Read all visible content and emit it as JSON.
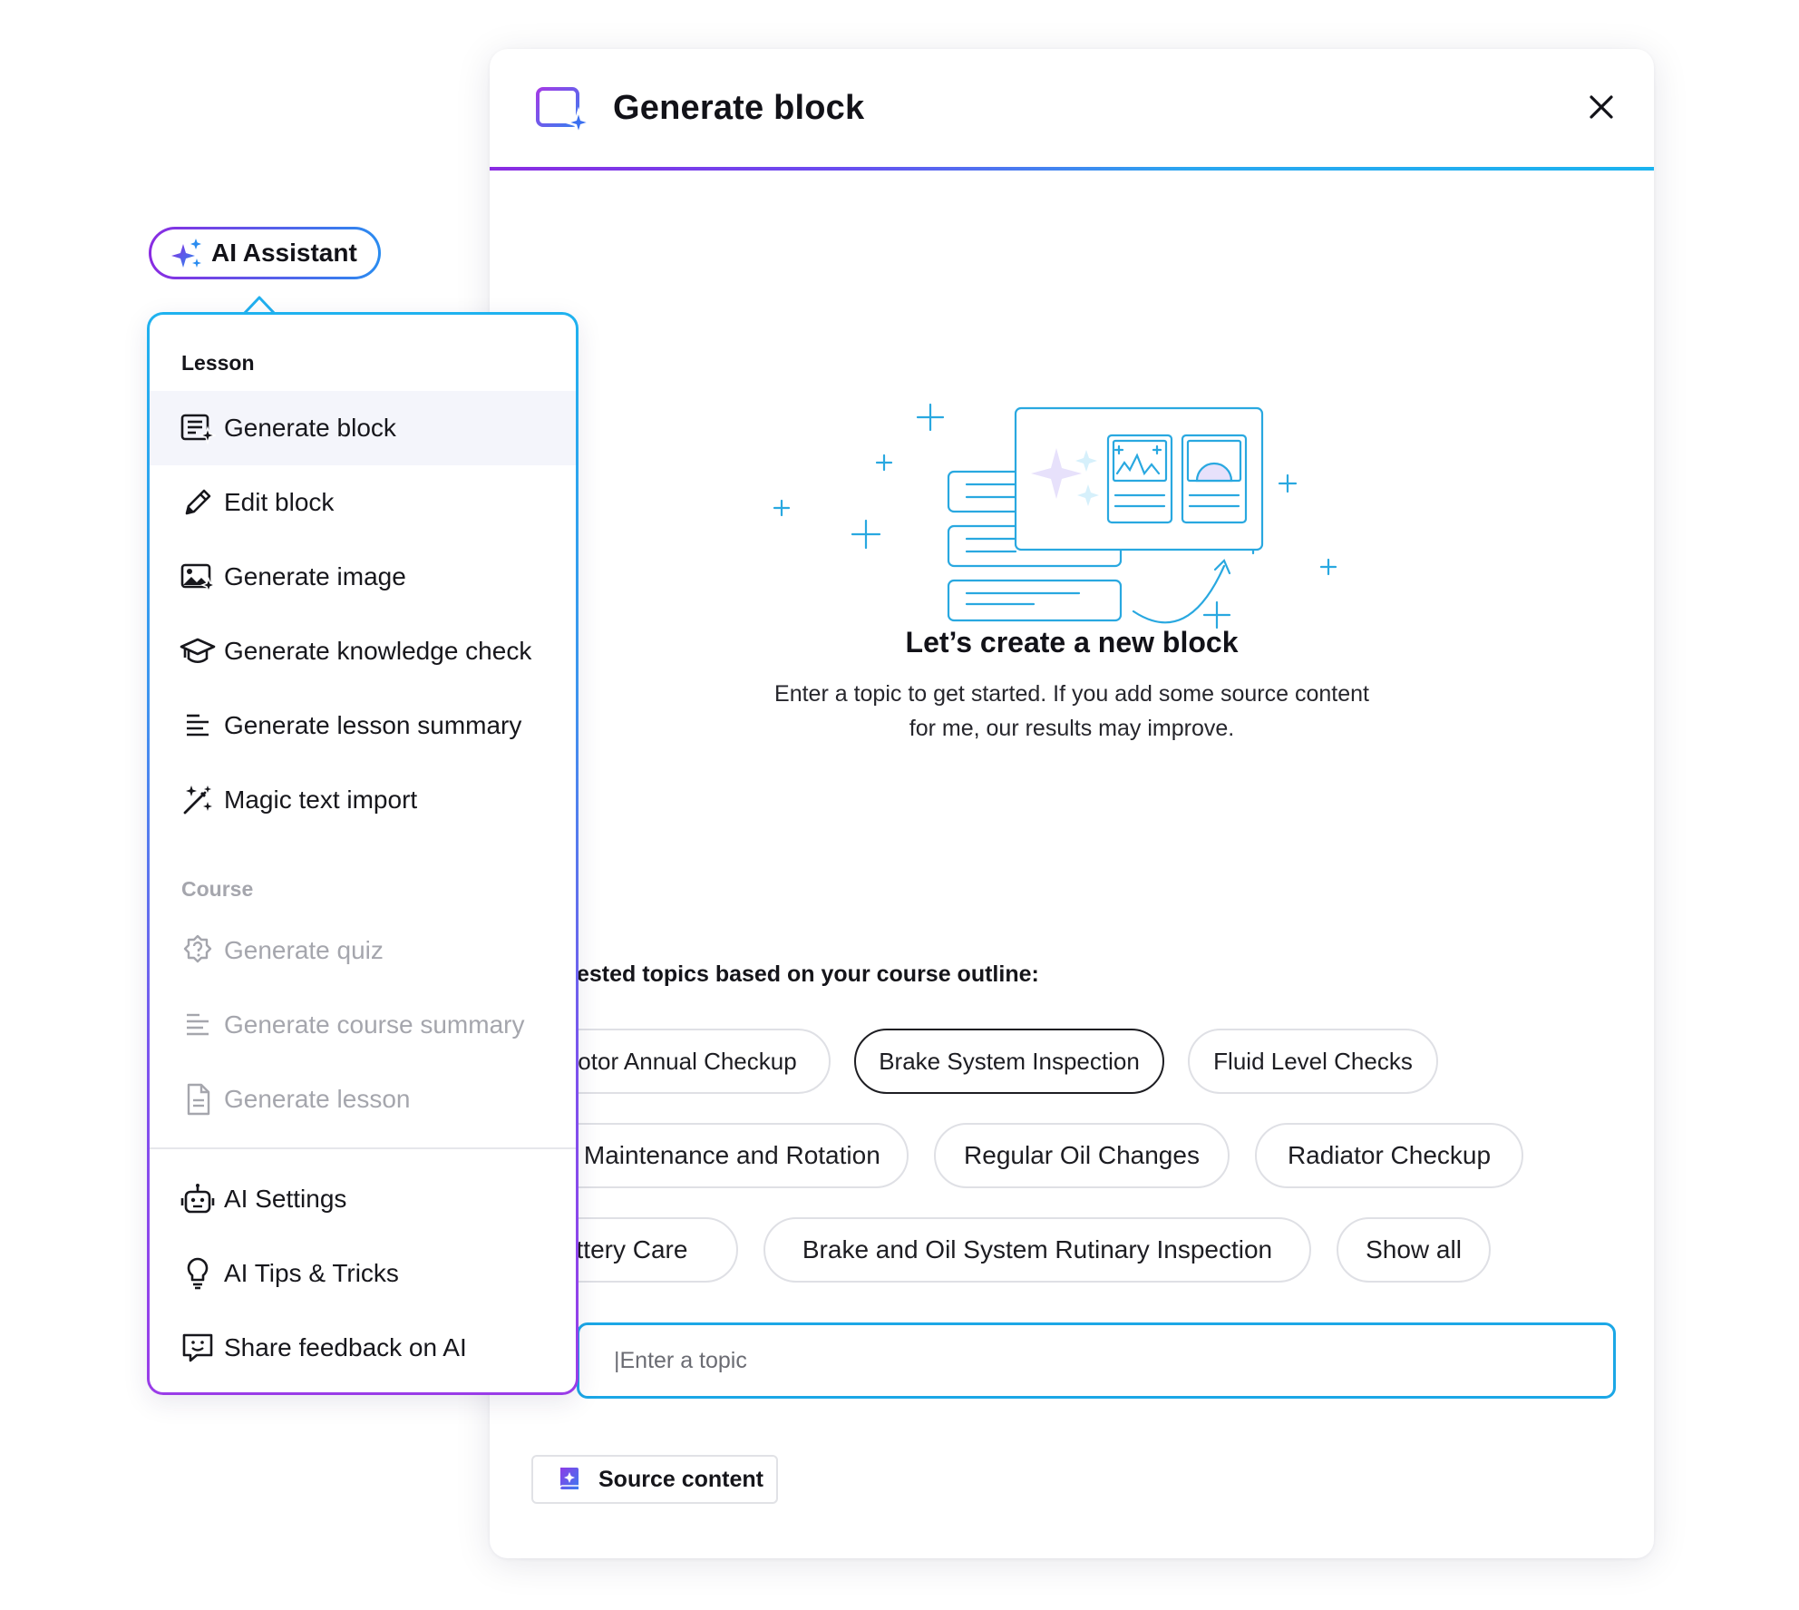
{
  "modal": {
    "title": "Generate block",
    "empty_state": {
      "title": "Let’s create a new block",
      "description": "Enter a topic to get started. If you add some source content for me, our results may improve."
    },
    "suggestions_label": "ested topics based on your course outline:",
    "chips": [
      "otor Annual Checkup",
      "Brake System Inspection",
      "Fluid Level Checks",
      "re Maintenance and Rotation",
      "Regular Oil Changes",
      "Radiator Checkup",
      "ttery Care",
      "Brake and Oil System Rutinary Inspection",
      "Show all"
    ],
    "selected_chip": "Brake System Inspection",
    "topic_input": {
      "value": "|Enter a topic"
    },
    "source_button": "Source content"
  },
  "ai_assistant": {
    "label": "AI Assistant",
    "menu": {
      "lesson_label": "Lesson",
      "lesson_items": [
        {
          "label": "Generate block",
          "icon": "generate-block-icon",
          "active": true
        },
        {
          "label": "Edit block",
          "icon": "pencil-icon"
        },
        {
          "label": "Generate image",
          "icon": "image-sparkle-icon"
        },
        {
          "label": "Generate knowledge check",
          "icon": "graduation-cap-icon"
        },
        {
          "label": "Generate lesson summary",
          "icon": "lines-icon"
        },
        {
          "label": "Magic text import",
          "icon": "magic-wand-icon"
        }
      ],
      "course_label": "Course",
      "course_items": [
        {
          "label": "Generate quiz",
          "icon": "quiz-icon",
          "disabled": true
        },
        {
          "label": "Generate course summary",
          "icon": "lines-icon",
          "disabled": true
        },
        {
          "label": "Generate lesson",
          "icon": "document-icon",
          "disabled": true
        }
      ],
      "footer_items": [
        {
          "label": "AI Settings",
          "icon": "robot-icon"
        },
        {
          "label": "AI Tips & Tricks",
          "icon": "lightbulb-icon"
        },
        {
          "label": "Share feedback on AI",
          "icon": "feedback-icon"
        }
      ]
    }
  },
  "colors": {
    "accent_blue": "#1ba7e6",
    "accent_purple": "#8a2be2",
    "illustration_blue": "#29a8e0",
    "text_dark": "#121218",
    "text_muted": "#a5a6ad"
  }
}
